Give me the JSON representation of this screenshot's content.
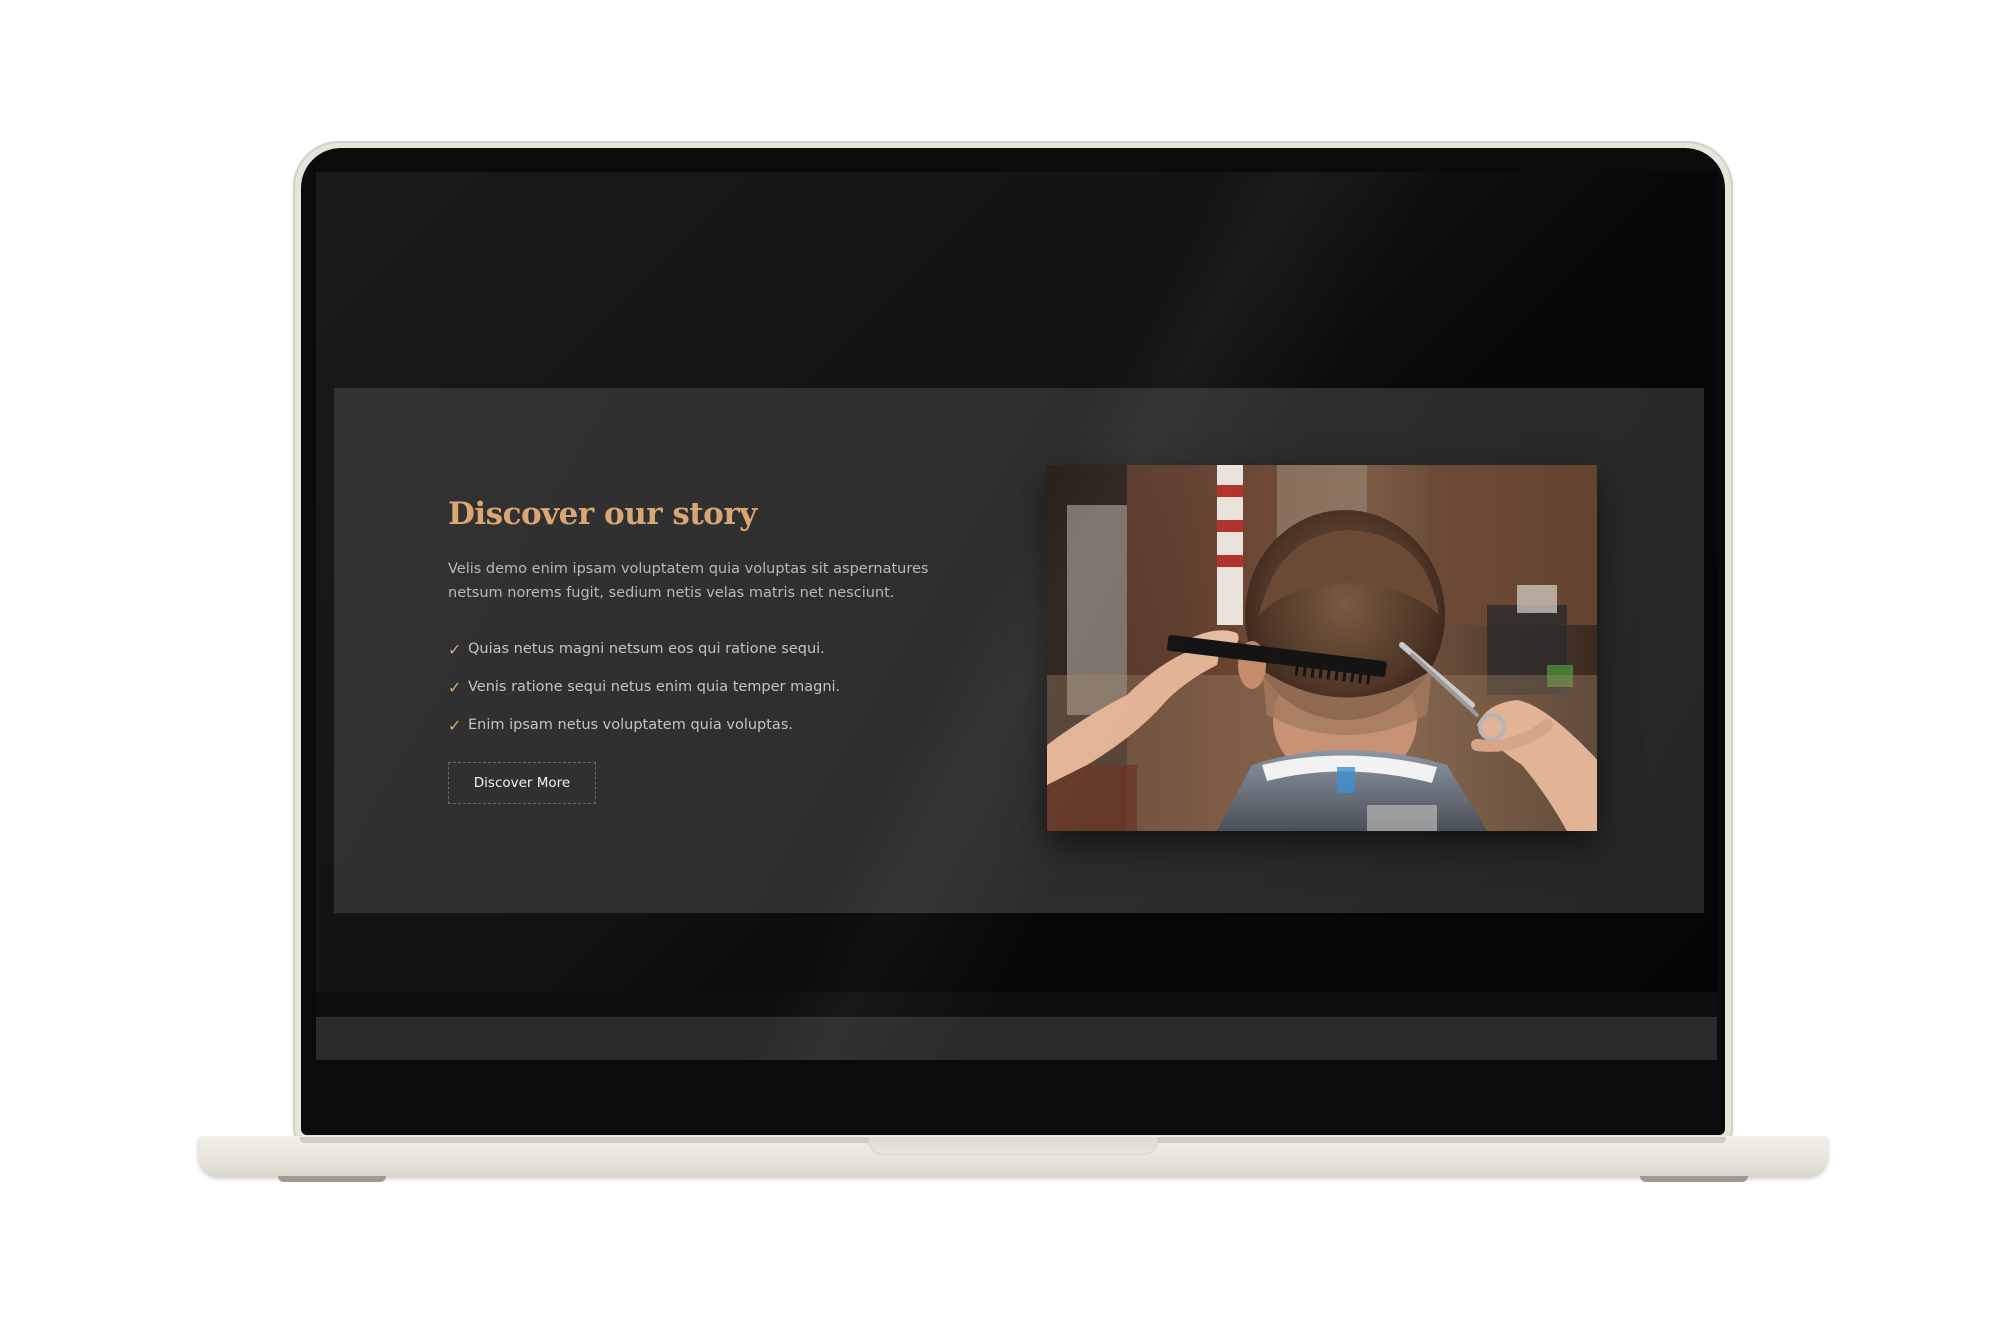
{
  "section": {
    "title": "Discover our story",
    "lead": "Velis demo enim ipsam voluptatem quia voluptas sit aspernatures netsum norems fugit, sedium netis velas matris net nesciunt.",
    "checklist": [
      "Quias netus magni netsum eos qui ratione sequi.",
      "Venis ratione sequi netus enim quia temper magni.",
      "Enim ipsam netus voluptatem quia voluptas."
    ],
    "check_icon": "check-icon",
    "cta_label": "Discover More"
  },
  "photo": {
    "subject": "barber-cutting-hair-photo"
  },
  "colors": {
    "accent": "#d9a772",
    "section_bg": "#2f2f30",
    "screen_bg": "#0b0b0b",
    "body_text": "#b9b9b9",
    "device_shell": "#e7e4dc"
  }
}
